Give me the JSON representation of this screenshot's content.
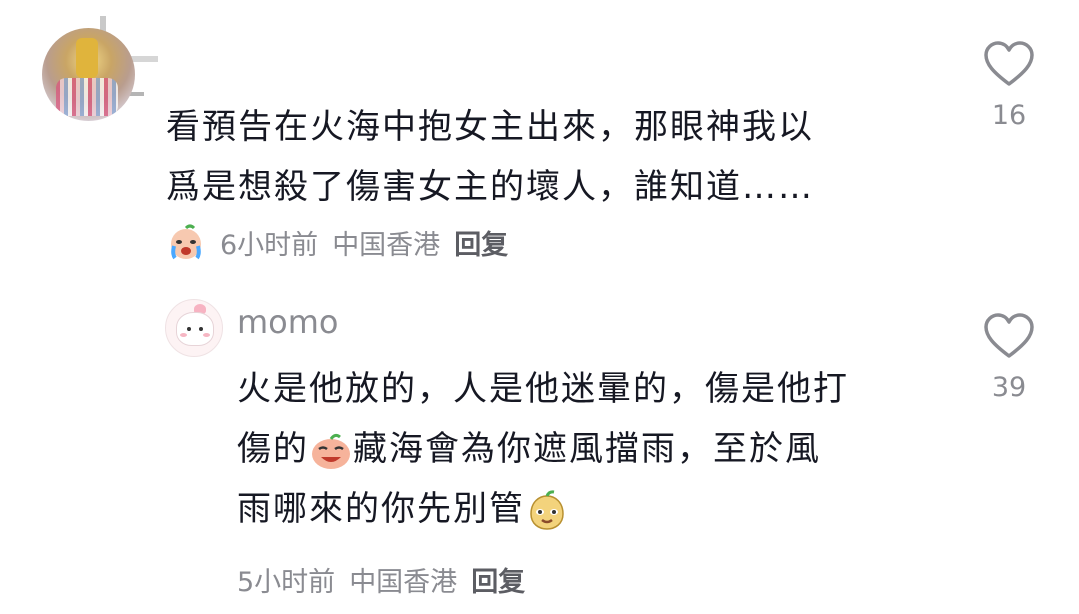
{
  "comments": [
    {
      "text_lines": [
        "看預告在火海中抱女主出來，那眼神我以",
        "爲是想殺了傷害女主的壞人，誰知道……"
      ],
      "time": "6小时前",
      "location": "中国香港",
      "reply_label": "回复",
      "likes": "16",
      "reaction_icon": "crying-face-icon"
    },
    {
      "username": "momo",
      "text_lines": [
        "火是他放的，人是他迷暈的，傷是他打",
        "傷的",
        "藏海會為你遮風擋雨，至於風",
        "雨哪來的你先別管"
      ],
      "time": "5小时前",
      "location": "中国香港",
      "reply_label": "回复",
      "likes": "39",
      "inline_icons": [
        "grinning-face-icon",
        "smug-face-icon"
      ]
    }
  ],
  "icons": {
    "like": "heart-outline-icon"
  }
}
